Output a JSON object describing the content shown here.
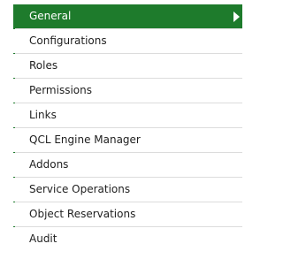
{
  "menu": {
    "items": [
      {
        "label": "General",
        "active": true
      },
      {
        "label": "Configurations",
        "active": false
      },
      {
        "label": "Roles",
        "active": false
      },
      {
        "label": "Permissions",
        "active": false
      },
      {
        "label": "Links",
        "active": false
      },
      {
        "label": "QCL Engine Manager",
        "active": false
      },
      {
        "label": "Addons",
        "active": false
      },
      {
        "label": "Service Operations",
        "active": false
      },
      {
        "label": "Object Reservations",
        "active": false
      },
      {
        "label": "Audit",
        "active": false
      }
    ],
    "active_arrow_icon": "chevron-right-icon",
    "accent_color": "#1e7b2c"
  }
}
